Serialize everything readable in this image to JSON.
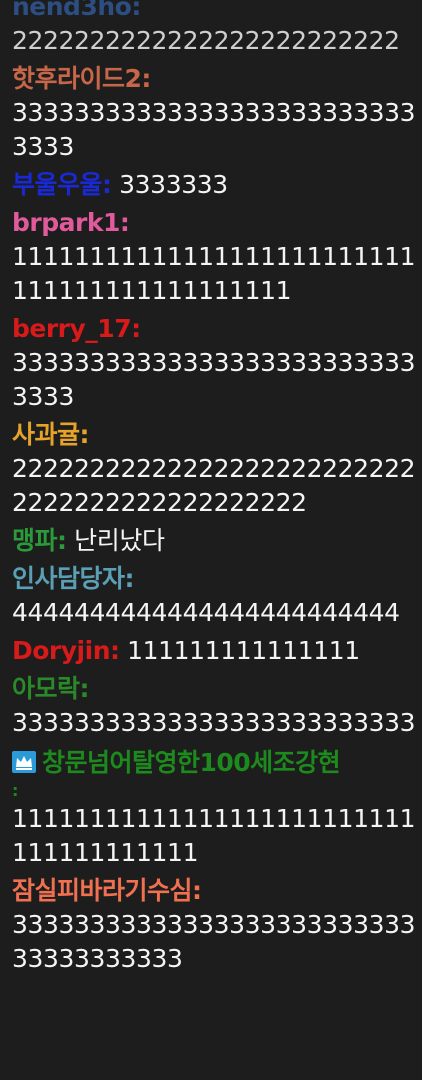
{
  "messages": [
    {
      "user": "nend3ho",
      "colon": ":",
      "text": "2222222222222222222222222",
      "color": "#2c4e82"
    },
    {
      "user": "핫후라이드2",
      "colon": ":",
      "text": "333333333333333333333333333333",
      "color": "#c8664a"
    },
    {
      "user": "부울우울",
      "colon": ":",
      "text": "3333333",
      "color": "#1a29d6"
    },
    {
      "user": "brpark1",
      "colon": ":",
      "text": "11111111111111111111111111111111111111111111",
      "color": "#e05a9c"
    },
    {
      "user": "berry_17",
      "colon": ":",
      "text": "333333333333333333333333333333",
      "color": "#d81a1a"
    },
    {
      "user": "사과귤",
      "colon": ":",
      "text": "222222222222222222222222222222222222222222222",
      "color": "#e6a32a"
    },
    {
      "user": "맹파",
      "colon": ":",
      "text": "난리났다",
      "color": "#2a9a3a"
    },
    {
      "user": "인사담당자",
      "colon": ":",
      "text": "4444444444444444444444444",
      "color": "#5a9fb4"
    },
    {
      "user": "Doryjin",
      "colon": ":",
      "text": "111111111111111",
      "color": "#d81a1a"
    },
    {
      "user": "아모락",
      "colon": ":",
      "text": "33333333333333333333333333",
      "color": "#2a8a2a"
    },
    {
      "user": "창문넘어탈영한100세조강현",
      "colon": ":",
      "text": "11111111111111111111111111111111111111",
      "color": "#1c8a1c",
      "badge": "crown-icon"
    },
    {
      "user": "잠실피바라기수심",
      "colon": ":",
      "text": "3333333333333333333333333333333333333",
      "color": "#f07050"
    }
  ]
}
